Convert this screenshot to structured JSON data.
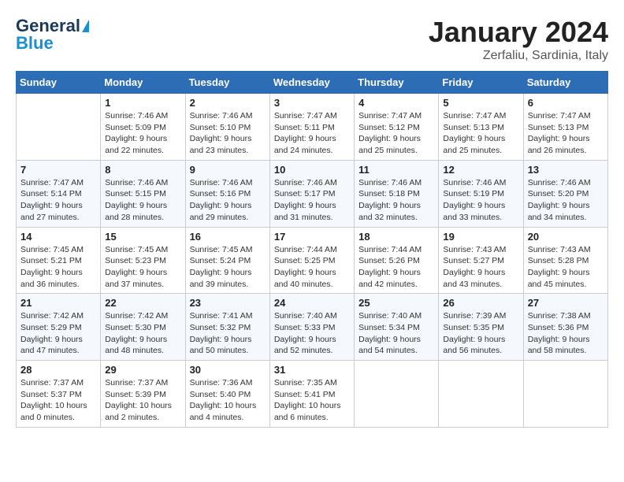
{
  "header": {
    "logo_general": "General",
    "logo_blue": "Blue",
    "title": "January 2024",
    "location": "Zerfaliu, Sardinia, Italy"
  },
  "weekdays": [
    "Sunday",
    "Monday",
    "Tuesday",
    "Wednesday",
    "Thursday",
    "Friday",
    "Saturday"
  ],
  "weeks": [
    [
      {
        "day": "",
        "sunrise": "",
        "sunset": "",
        "daylight": ""
      },
      {
        "day": "1",
        "sunrise": "7:46 AM",
        "sunset": "5:09 PM",
        "daylight": "9 hours and 22 minutes."
      },
      {
        "day": "2",
        "sunrise": "7:46 AM",
        "sunset": "5:10 PM",
        "daylight": "9 hours and 23 minutes."
      },
      {
        "day": "3",
        "sunrise": "7:47 AM",
        "sunset": "5:11 PM",
        "daylight": "9 hours and 24 minutes."
      },
      {
        "day": "4",
        "sunrise": "7:47 AM",
        "sunset": "5:12 PM",
        "daylight": "9 hours and 25 minutes."
      },
      {
        "day": "5",
        "sunrise": "7:47 AM",
        "sunset": "5:13 PM",
        "daylight": "9 hours and 25 minutes."
      },
      {
        "day": "6",
        "sunrise": "7:47 AM",
        "sunset": "5:13 PM",
        "daylight": "9 hours and 26 minutes."
      }
    ],
    [
      {
        "day": "7",
        "sunrise": "7:47 AM",
        "sunset": "5:14 PM",
        "daylight": "9 hours and 27 minutes."
      },
      {
        "day": "8",
        "sunrise": "7:46 AM",
        "sunset": "5:15 PM",
        "daylight": "9 hours and 28 minutes."
      },
      {
        "day": "9",
        "sunrise": "7:46 AM",
        "sunset": "5:16 PM",
        "daylight": "9 hours and 29 minutes."
      },
      {
        "day": "10",
        "sunrise": "7:46 AM",
        "sunset": "5:17 PM",
        "daylight": "9 hours and 31 minutes."
      },
      {
        "day": "11",
        "sunrise": "7:46 AM",
        "sunset": "5:18 PM",
        "daylight": "9 hours and 32 minutes."
      },
      {
        "day": "12",
        "sunrise": "7:46 AM",
        "sunset": "5:19 PM",
        "daylight": "9 hours and 33 minutes."
      },
      {
        "day": "13",
        "sunrise": "7:46 AM",
        "sunset": "5:20 PM",
        "daylight": "9 hours and 34 minutes."
      }
    ],
    [
      {
        "day": "14",
        "sunrise": "7:45 AM",
        "sunset": "5:21 PM",
        "daylight": "9 hours and 36 minutes."
      },
      {
        "day": "15",
        "sunrise": "7:45 AM",
        "sunset": "5:23 PM",
        "daylight": "9 hours and 37 minutes."
      },
      {
        "day": "16",
        "sunrise": "7:45 AM",
        "sunset": "5:24 PM",
        "daylight": "9 hours and 39 minutes."
      },
      {
        "day": "17",
        "sunrise": "7:44 AM",
        "sunset": "5:25 PM",
        "daylight": "9 hours and 40 minutes."
      },
      {
        "day": "18",
        "sunrise": "7:44 AM",
        "sunset": "5:26 PM",
        "daylight": "9 hours and 42 minutes."
      },
      {
        "day": "19",
        "sunrise": "7:43 AM",
        "sunset": "5:27 PM",
        "daylight": "9 hours and 43 minutes."
      },
      {
        "day": "20",
        "sunrise": "7:43 AM",
        "sunset": "5:28 PM",
        "daylight": "9 hours and 45 minutes."
      }
    ],
    [
      {
        "day": "21",
        "sunrise": "7:42 AM",
        "sunset": "5:29 PM",
        "daylight": "9 hours and 47 minutes."
      },
      {
        "day": "22",
        "sunrise": "7:42 AM",
        "sunset": "5:30 PM",
        "daylight": "9 hours and 48 minutes."
      },
      {
        "day": "23",
        "sunrise": "7:41 AM",
        "sunset": "5:32 PM",
        "daylight": "9 hours and 50 minutes."
      },
      {
        "day": "24",
        "sunrise": "7:40 AM",
        "sunset": "5:33 PM",
        "daylight": "9 hours and 52 minutes."
      },
      {
        "day": "25",
        "sunrise": "7:40 AM",
        "sunset": "5:34 PM",
        "daylight": "9 hours and 54 minutes."
      },
      {
        "day": "26",
        "sunrise": "7:39 AM",
        "sunset": "5:35 PM",
        "daylight": "9 hours and 56 minutes."
      },
      {
        "day": "27",
        "sunrise": "7:38 AM",
        "sunset": "5:36 PM",
        "daylight": "9 hours and 58 minutes."
      }
    ],
    [
      {
        "day": "28",
        "sunrise": "7:37 AM",
        "sunset": "5:37 PM",
        "daylight": "10 hours and 0 minutes."
      },
      {
        "day": "29",
        "sunrise": "7:37 AM",
        "sunset": "5:39 PM",
        "daylight": "10 hours and 2 minutes."
      },
      {
        "day": "30",
        "sunrise": "7:36 AM",
        "sunset": "5:40 PM",
        "daylight": "10 hours and 4 minutes."
      },
      {
        "day": "31",
        "sunrise": "7:35 AM",
        "sunset": "5:41 PM",
        "daylight": "10 hours and 6 minutes."
      },
      {
        "day": "",
        "sunrise": "",
        "sunset": "",
        "daylight": ""
      },
      {
        "day": "",
        "sunrise": "",
        "sunset": "",
        "daylight": ""
      },
      {
        "day": "",
        "sunrise": "",
        "sunset": "",
        "daylight": ""
      }
    ]
  ]
}
